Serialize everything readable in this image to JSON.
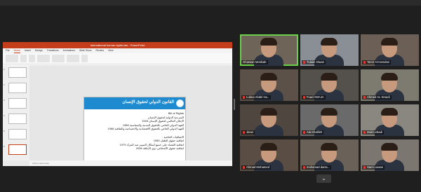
{
  "presentation": {
    "window_title": "International human rights law - PowerPoint",
    "tabs": [
      "File",
      "Home",
      "Insert",
      "Design",
      "Transitions",
      "Animations",
      "Slide Show",
      "Review",
      "View"
    ],
    "active_tab": "Home",
    "slide_title": "القانون الدولي لحقوق الإنسان",
    "slide_lines": [
      "Bill of Rights",
      "الشرعية الدولية لحقوق الإنسان",
      "الإعلان العالمي لحقوق الإنسان 1948",
      "العهد الدولي الخاص بالحقوق المدنية والسياسية 1966",
      "العهد الدولي الخاص بالحقوق الاقتصادية والاجتماعية والثقافية 1966",
      "",
      "الاتفاقيات الخاصة :",
      "اتفاقية حقوق الطفل 1989",
      "اتفاقية القضاء على جميع أشكال التمييز ضد المرأة 1979",
      "اتفاقية حقوق الأشخاص ذوي الإعاقة 2006"
    ],
    "notes_placeholder": "Click to add notes",
    "thumbnail_count": 6,
    "selected_thumbnail": 6,
    "brand_color": "#c43e1c",
    "slide_accent": "#1e8ad0"
  },
  "participants": [
    {
      "name": "Ghassan Mekkiah",
      "tone": "#6f6458",
      "active": true,
      "muted": false
    },
    {
      "name": "Tulaim Diwan",
      "tone": "#8a8f95",
      "active": false,
      "muted": true
    },
    {
      "name": "Tamir Al-Hamdan",
      "tone": "#6c5f55",
      "active": false,
      "muted": true
    },
    {
      "name": "Lubna Abdel Ha...",
      "tone": "#5b5148",
      "active": false,
      "muted": true
    },
    {
      "name": "Fuad AWAJA",
      "tone": "#54504b",
      "active": false,
      "muted": true
    },
    {
      "name": "Ahmed AL-Smadi",
      "tone": "#7d7a70",
      "active": false,
      "muted": true
    },
    {
      "name": "Jinan",
      "tone": "#4e463f",
      "active": false,
      "muted": true
    },
    {
      "name": "Ala Khalifeh",
      "tone": "#6a6a6a",
      "active": false,
      "muted": true
    },
    {
      "name": "Zaid Lebadi",
      "tone": "#8a8780",
      "active": false,
      "muted": true
    },
    {
      "name": "Ahmad Mohamed",
      "tone": "#5a4d44",
      "active": false,
      "muted": true
    },
    {
      "name": "mohamad darra...",
      "tone": "#6a6158",
      "active": false,
      "muted": true
    },
    {
      "name": "Sami Lawas",
      "tone": "#7c7670",
      "active": false,
      "muted": true
    }
  ],
  "controls": {
    "collapse_icon": "chevron-down-icon",
    "collapse_glyph": "⌄"
  }
}
